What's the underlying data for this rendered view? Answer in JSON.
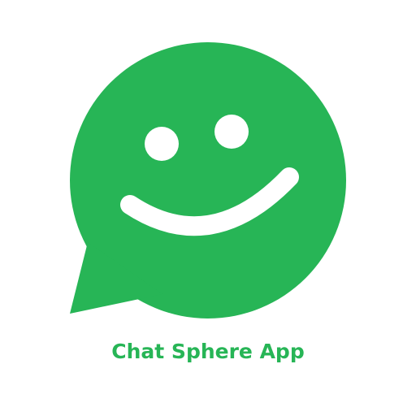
{
  "app": {
    "name": "Chat Sphere App"
  },
  "logo": {
    "icon": "smiley-chat-bubble-icon",
    "brand_color": "#27b556",
    "face_color": "#ffffff"
  }
}
